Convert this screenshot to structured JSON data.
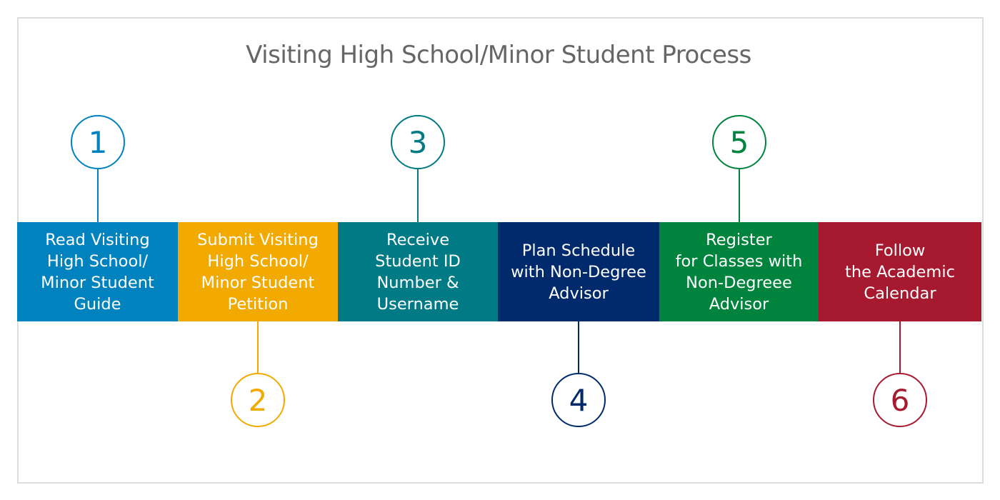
{
  "title": "Visiting High School/Minor Student Process",
  "steps": [
    {
      "number": "1",
      "label": "Read Visiting\nHigh School/\nMinor Student\nGuide",
      "color": "#0082bf",
      "circle_position": "top"
    },
    {
      "number": "2",
      "label": "Submit Visiting\nHigh School/\nMinor Student\nPetition",
      "color": "#f2a900",
      "circle_position": "bottom"
    },
    {
      "number": "3",
      "label": "Receive\nStudent ID\nNumber &\nUsername",
      "color": "#007b85",
      "circle_position": "top"
    },
    {
      "number": "4",
      "label": "Plan Schedule\nwith Non-Degree\nAdvisor",
      "color": "#002a6c",
      "circle_position": "bottom"
    },
    {
      "number": "5",
      "label": "Register\nfor Classes with\nNon-Degreee\nAdvisor",
      "color": "#00843d",
      "circle_position": "top"
    },
    {
      "number": "6",
      "label": "Follow\nthe Academic\nCalendar",
      "color": "#a6192e",
      "circle_position": "bottom"
    }
  ]
}
